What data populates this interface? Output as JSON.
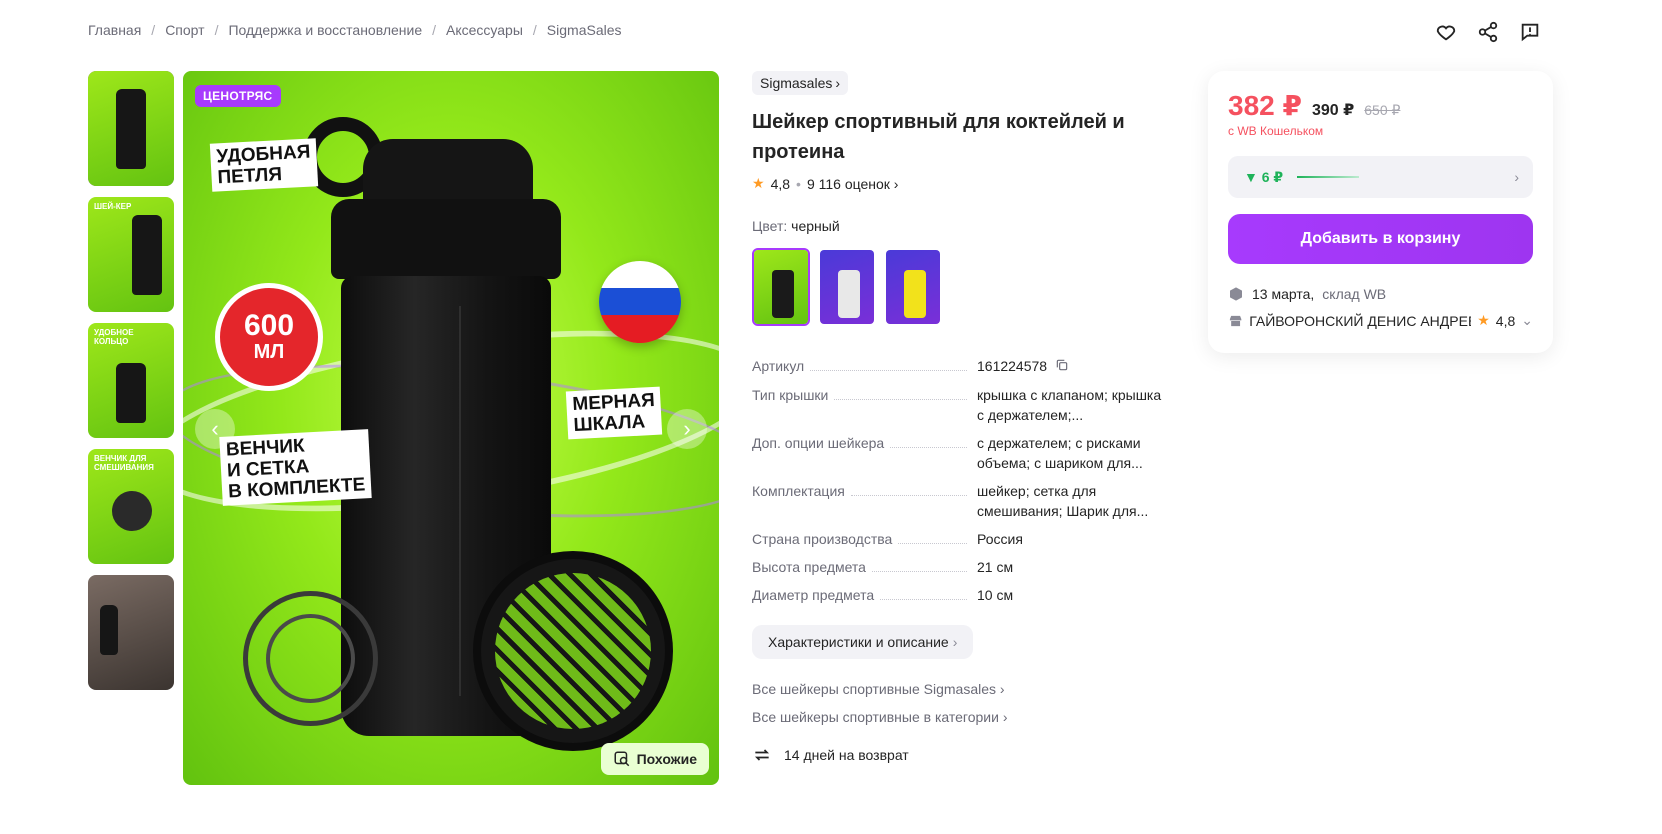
{
  "breadcrumb": [
    {
      "label": "Главная"
    },
    {
      "label": "Спорт"
    },
    {
      "label": "Поддержка и восстановление"
    },
    {
      "label": "Аксессуары"
    },
    {
      "label": "SigmaSales"
    }
  ],
  "gallery": {
    "badge": "ЦЕНОТРЯС",
    "volume_number": "600",
    "volume_unit": "МЛ",
    "label_loop_1": "УДОБНАЯ",
    "label_loop_2": "ПЕТЛЯ",
    "label_scale_1": "МЕРНАЯ",
    "label_scale_2": "ШКАЛА",
    "label_whisk_1": "ВЕНЧИК",
    "label_whisk_2": "И СЕТКА",
    "label_whisk_3": "В КОМПЛЕКТЕ",
    "similar_label": "Похожие",
    "thumbs": [
      {
        "caption": ""
      },
      {
        "caption": "ШЕЙ-КЕР"
      },
      {
        "caption": "УДОБНОЕ КОЛЬЦО"
      },
      {
        "caption": "ВЕНЧИК ДЛЯ СМЕШИВАНИЯ"
      },
      {
        "caption": ""
      }
    ]
  },
  "product": {
    "brand": "Sigmasales",
    "title": "Шейкер спортивный для коктейлей и протеина",
    "rating": "4,8",
    "reviews": "9 116 оценок",
    "color_label": "Цвет:",
    "color_value": "черный",
    "variant_colors": [
      "#1a1a1a",
      "#e8e8e8",
      "#f2e21b"
    ]
  },
  "specs": [
    {
      "key": "Артикул",
      "value": "161224578"
    },
    {
      "key": "Тип крышки",
      "value": "крышка с клапаном; крышка с держателем;..."
    },
    {
      "key": "Доп. опции шейкера",
      "value": "с держателем; с рисками объема; с шариком для..."
    },
    {
      "key": "Комплектация",
      "value": "шейкер; сетка для смешивания; Шарик для..."
    },
    {
      "key": "Страна производства",
      "value": "Россия"
    },
    {
      "key": "Высота предмета",
      "value": "21 см"
    },
    {
      "key": "Диаметр предмета",
      "value": "10 см"
    }
  ],
  "specs_button": "Характеристики и описание",
  "links": {
    "brand_all": "Все шейкеры спортивные Sigmasales",
    "category_all": "Все шейкеры спортивные в категории"
  },
  "returns": "14 дней на возврат",
  "price": {
    "main": "382 ₽",
    "alt": "390 ₽",
    "old": "650 ₽",
    "wallet_note": "с WB Кошельком",
    "cashback": "▼ 6 ₽",
    "cart_button": "Добавить в корзину",
    "delivery_date": "13 марта,",
    "delivery_warehouse": "склад WB",
    "seller_name": "ГАЙВОРОНСКИЙ ДЕНИС АНДРЕЕВИЧ",
    "seller_rating": "4,8"
  },
  "colors": {
    "accent": "#a73afd",
    "price": "#f5515f",
    "cashback": "#1fb35a"
  }
}
